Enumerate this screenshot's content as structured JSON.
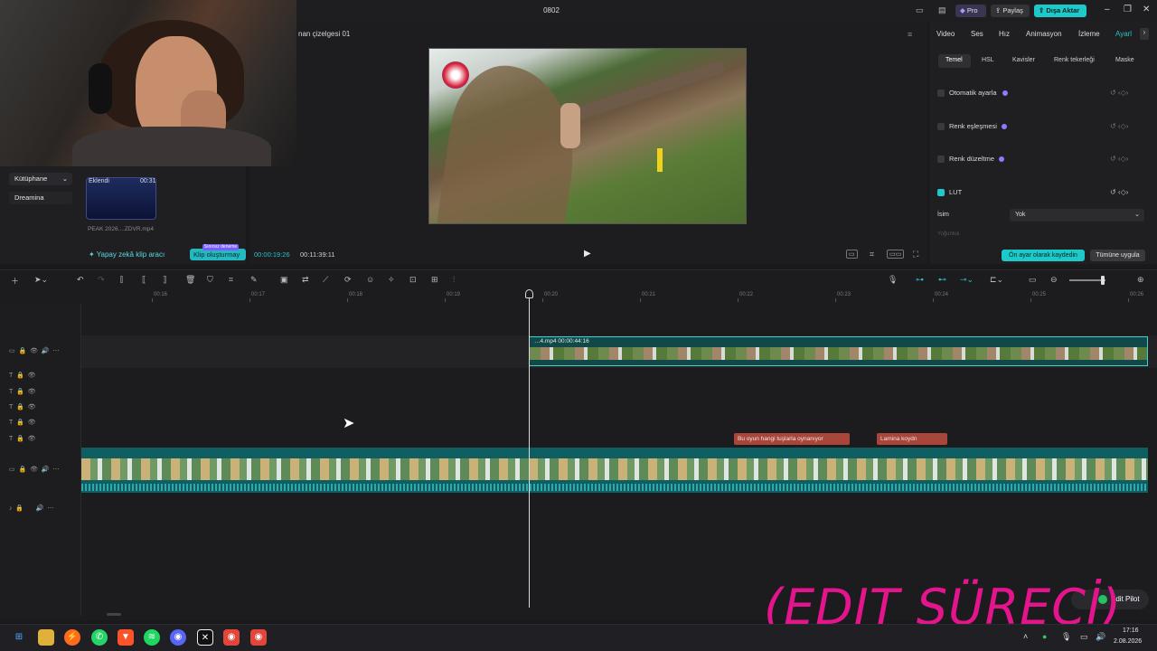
{
  "window": {
    "title": "0802"
  },
  "header": {
    "pro": "Pro",
    "share": "Paylaş",
    "export": "Dışa Aktar"
  },
  "player": {
    "title": "nan çizelgesi 01",
    "time_current": "00:00:19:26",
    "time_total": "00:11:39:11"
  },
  "media": {
    "sidebar": [
      {
        "label": "Kütüphane"
      },
      {
        "label": "Dreamina"
      }
    ],
    "thumb": {
      "status": "Eklendi",
      "duration": "00:31",
      "name": "PEAK 2026....ZDVR.mp4"
    },
    "ai_tool": "Yapay zekâ klip aracı",
    "clip_create": "Klip oluşturmay",
    "clip_badge": "Sınırsız deneme"
  },
  "inspector": {
    "tabs": [
      {
        "label": "Video"
      },
      {
        "label": "Ses"
      },
      {
        "label": "Hız"
      },
      {
        "label": "Animasyon"
      },
      {
        "label": "İzleme"
      },
      {
        "label": "Ayarl"
      }
    ],
    "subtabs": [
      {
        "label": "Temel"
      },
      {
        "label": "HSL"
      },
      {
        "label": "Kavisler"
      },
      {
        "label": "Renk tekerleği"
      },
      {
        "label": "Maske"
      }
    ],
    "rows": [
      {
        "label": "Otomatik ayarla"
      },
      {
        "label": "Renk eşleşmesi"
      },
      {
        "label": "Renk düzeltme"
      }
    ],
    "lut": {
      "label": "LUT",
      "name_label": "İsim",
      "name_value": "Yok",
      "faded": "Yoğunluk"
    },
    "save_preset": "Ön ayar olarak kaydedin",
    "apply_all": "Tümüne uygula"
  },
  "timeline": {
    "ruler": [
      "00:16",
      "00:17",
      "00:18",
      "00:19",
      "00:20",
      "00:21",
      "00:22",
      "00:23",
      "00:24",
      "00:25",
      "00:26"
    ],
    "top_clip": "…4.mp4   00:00:44:16",
    "text_clips": [
      "Bu oyun hangi tuşlarla oynanıyor",
      "Lamina koydn"
    ]
  },
  "overlay": {
    "edit_text": "(EDIT SÜRECİ)",
    "editpilot": "Edit Pilot"
  },
  "taskbar": {
    "time": "17:16",
    "date": "2.08.2026"
  },
  "colors": {
    "accent": "#1ec9c9",
    "overlay_pink": "#e4148c",
    "text_clip": "#a8463b"
  },
  "icons": [
    "windows-start-icon",
    "folder-icon",
    "play-icon",
    "undo-icon",
    "redo-icon",
    "split-icon",
    "delete-icon",
    "mic-icon",
    "zoom-out-icon",
    "zoom-in-icon"
  ]
}
